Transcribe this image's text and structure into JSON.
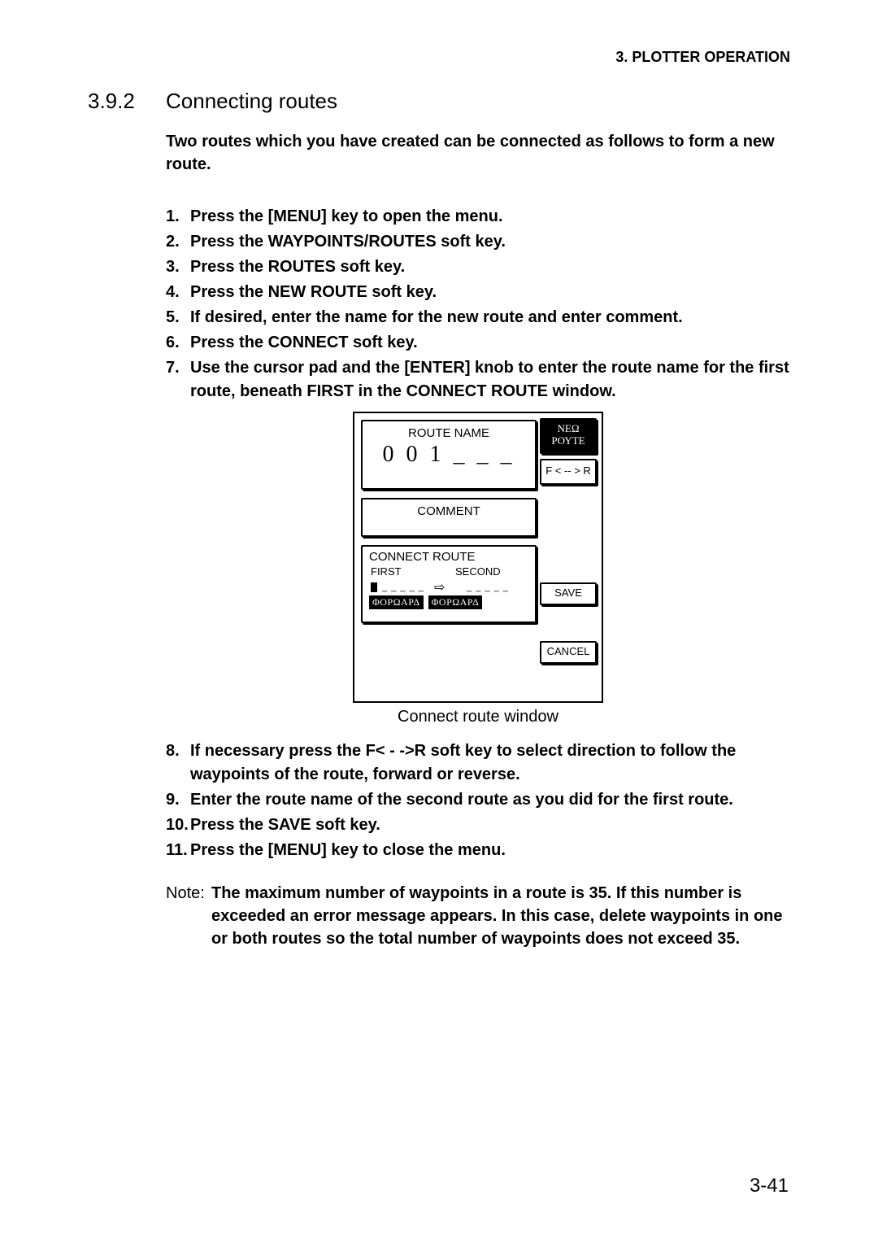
{
  "header": "3. PLOTTER OPERATION",
  "section": {
    "number": "3.9.2",
    "title": "Connecting routes"
  },
  "intro": "Two routes which you have created can be connected as follows to form a new route.",
  "steps1": [
    "Press the [MENU] key to open the menu.",
    "Press the WAYPOINTS/ROUTES soft key.",
    "Press the ROUTES soft key.",
    "Press the NEW ROUTE soft key.",
    "If desired, enter the name for the new route and enter comment.",
    "Press the CONNECT soft key.",
    "Use the cursor pad and the [ENTER] knob to enter the route name for the first route, beneath FIRST in the CONNECT ROUTE window."
  ],
  "figure": {
    "routeNameLabel": "ROUTE NAME",
    "routeNameValue": "0 0 1 _ _ _",
    "commentLabel": "COMMENT",
    "connectTitle": "CONNECT ROUTE",
    "firstLabel": "FIRST",
    "secondLabel": "SECOND",
    "dashed": "_ _ _ _ _",
    "arrow": "⇨",
    "forwardBadge": "ΦΟΡΩΑΡΔ",
    "softkeys": {
      "newRoute": "ΝΕΩ\nΡΟΥΤΕ",
      "fr": "F < -- > R",
      "save": "SAVE",
      "cancel": "CANCEL"
    },
    "caption": "Connect route window"
  },
  "steps2": [
    {
      "n": "8.",
      "t": "If necessary press the F< - ->R soft key to select direction to follow the waypoints of the route, forward or reverse."
    },
    {
      "n": "9.",
      "t": "Enter the route name of the second route as you did for the first route."
    },
    {
      "n": "10.",
      "t": "Press the SAVE soft key."
    },
    {
      "n": "11.",
      "t": "Press the [MENU] key to close the menu."
    }
  ],
  "note": {
    "label": "Note:",
    "text": "The maximum number of waypoints in a route is 35. If this number is exceeded an error message appears. In this case, delete waypoints in one or both routes so the total number of waypoints does not exceed 35."
  },
  "pageNumber": "3-41"
}
